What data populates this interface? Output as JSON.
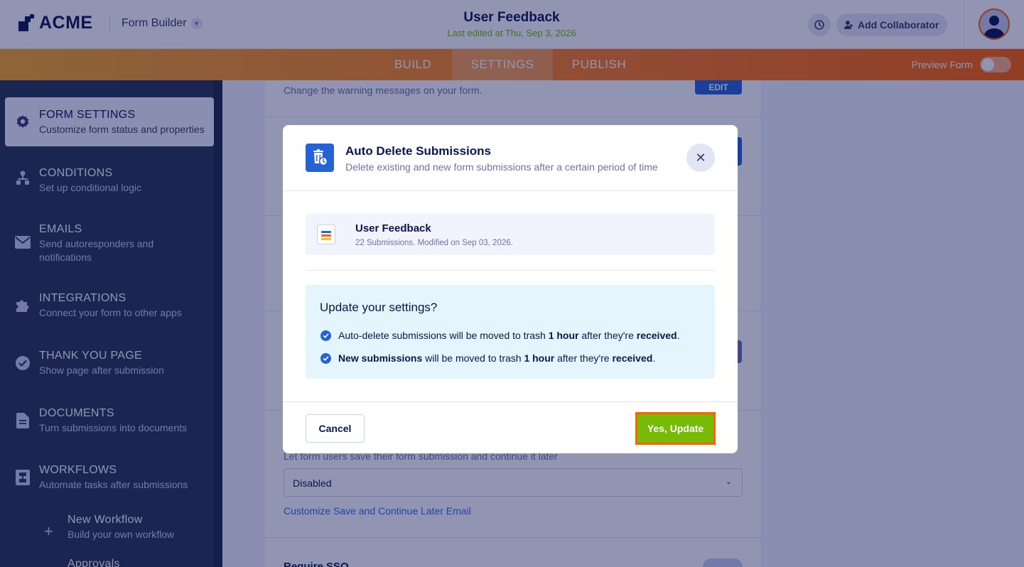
{
  "header": {
    "logo_text": "ACME",
    "app_switcher_label": "Form Builder",
    "form_title": "User Feedback",
    "last_edited": "Last edited at Thu, Sep 3, 2026",
    "add_collaborator_label": "Add Collaborator"
  },
  "nav": {
    "tabs": [
      {
        "label": "BUILD"
      },
      {
        "label": "SETTINGS",
        "active": true
      },
      {
        "label": "PUBLISH"
      }
    ],
    "preview_label": "Preview Form"
  },
  "sidebar": {
    "items": [
      {
        "title": "FORM SETTINGS",
        "subtitle": "Customize form status and properties",
        "icon": "gear-icon",
        "active": true
      },
      {
        "title": "CONDITIONS",
        "subtitle": "Set up conditional logic",
        "icon": "conditions-icon"
      },
      {
        "title": "EMAILS",
        "subtitle": "Send autoresponders and notifications",
        "icon": "mail-icon"
      },
      {
        "title": "INTEGRATIONS",
        "subtitle": "Connect your form to other apps",
        "icon": "puzzle-icon"
      },
      {
        "title": "THANK YOU PAGE",
        "subtitle": "Show page after submission",
        "icon": "check-circle-icon"
      },
      {
        "title": "DOCUMENTS",
        "subtitle": "Turn submissions into documents",
        "icon": "document-icon"
      },
      {
        "title": "WORKFLOWS",
        "subtitle": "Automate tasks after submissions",
        "icon": "workflow-icon"
      }
    ],
    "sub_items": [
      {
        "title": "New Workflow",
        "subtitle": "Build your own workflow",
        "icon": "plus-icon"
      },
      {
        "title": "Approvals"
      }
    ]
  },
  "background": {
    "warning_text": "Change the warning messages on your form.",
    "edit_label": "EDIT",
    "save_continue_text": "Let form users save their form submission and continue it later",
    "save_continue_value": "Disabled",
    "customize_link": "Customize Save and Continue Later Email",
    "require_sso": "Require SSO"
  },
  "modal": {
    "title": "Auto Delete Submissions",
    "subtitle": "Delete existing and new form submissions after a certain period of time",
    "form_name": "User Feedback",
    "form_meta": "22 Submissions. Modified on Sep 03, 2026.",
    "question": "Update your settings?",
    "line1": {
      "a": "Auto-delete submissions will be moved to trash ",
      "b": "1 hour",
      "c": " after they're ",
      "d": "received",
      "e": "."
    },
    "line2": {
      "a": "New submissions",
      "b": " will be moved to trash ",
      "c": "1 hour",
      "d": " after they're ",
      "e": "received",
      "f": "."
    },
    "cancel_label": "Cancel",
    "confirm_label": "Yes, Update"
  },
  "colors": {
    "accent_orange": "#ff6100",
    "primary_blue": "#2563d5",
    "success_green": "#78bb07",
    "navy": "#0a1551"
  }
}
